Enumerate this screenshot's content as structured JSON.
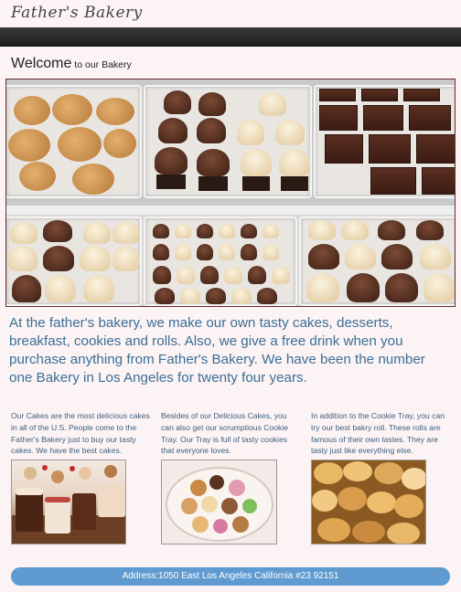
{
  "header": {
    "logo": "Father's Bakery"
  },
  "welcome": {
    "title_big": "Welcome",
    "title_small": " to our Bakery"
  },
  "hero": {
    "alt": "bakery display of cookies, cupcakes and brownies"
  },
  "intro": {
    "text": "At the father's bakery, we make our own tasty cakes, desserts, breakfast, cookies and rolls. Also, we give a free drink when you purchase anything from Father's Bakery. We have been the number one Bakery in Los Angeles for twenty four years."
  },
  "columns": [
    {
      "text": "Our Cakes are the most delicious cakes in all of the U.S. People come to the Father's Bakery just to buy our tasty cakes. We have the best cakes."
    },
    {
      "text": "Besides of our Delicious Cakes, you can also get our scrumptious Cookie Tray. Our Tray is full of tasty cookies that everyone loves."
    },
    {
      "text": "In addition to the Cookie Tray, you can try our best bakry roll. These rolls are famous of their own tastes. They are tasty just like everything else."
    }
  ],
  "footer": {
    "address": "Address:1050 East Los Angeles California #23 92151"
  },
  "colors": {
    "page_bg": "#fcf3f4",
    "accent_blue": "#3b6f97",
    "footer_bg": "#5f9bd0",
    "navbar": "#2b2b2b"
  }
}
